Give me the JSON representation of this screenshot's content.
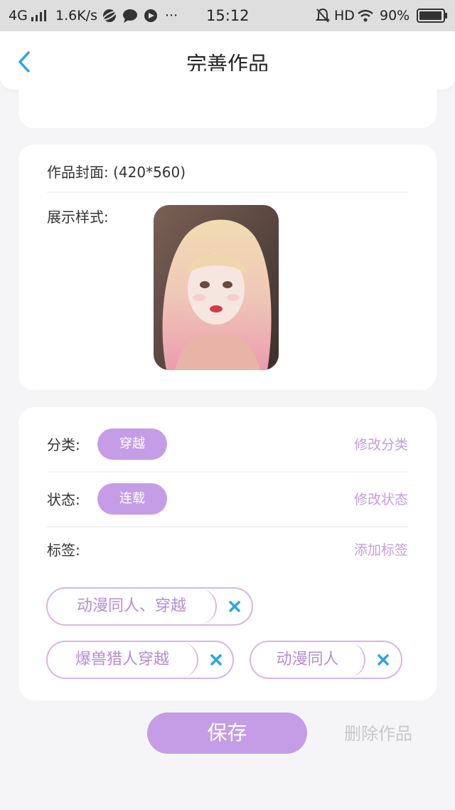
{
  "status_bar": {
    "network": "4G",
    "speed": "1.6K/s",
    "more": "···",
    "time": "15:12",
    "hd": "HD",
    "battery": "90%"
  },
  "header": {
    "title": "完善作品"
  },
  "cover": {
    "cover_label": "作品封面: (420*560)",
    "display_label": "展示样式:",
    "image_description": "Portrait photo of a person with blonde-to-pink hair"
  },
  "info": {
    "category_label": "分类:",
    "category_value": "穿越",
    "category_action": "修改分类",
    "status_label": "状态:",
    "status_value": "连载",
    "status_action": "修改状态",
    "tags_label": "标签:",
    "tags_action": "添加标签",
    "tags": [
      "动漫同人、穿越",
      "爆兽猎人穿越",
      "动漫同人"
    ]
  },
  "footer": {
    "save": "保存",
    "delete": "删除作品"
  },
  "colors": {
    "accent": "#c49de6",
    "accent_border": "#d6b6ec",
    "remove_x": "#2aa6e6",
    "back_arrow": "#2aa6e6"
  }
}
